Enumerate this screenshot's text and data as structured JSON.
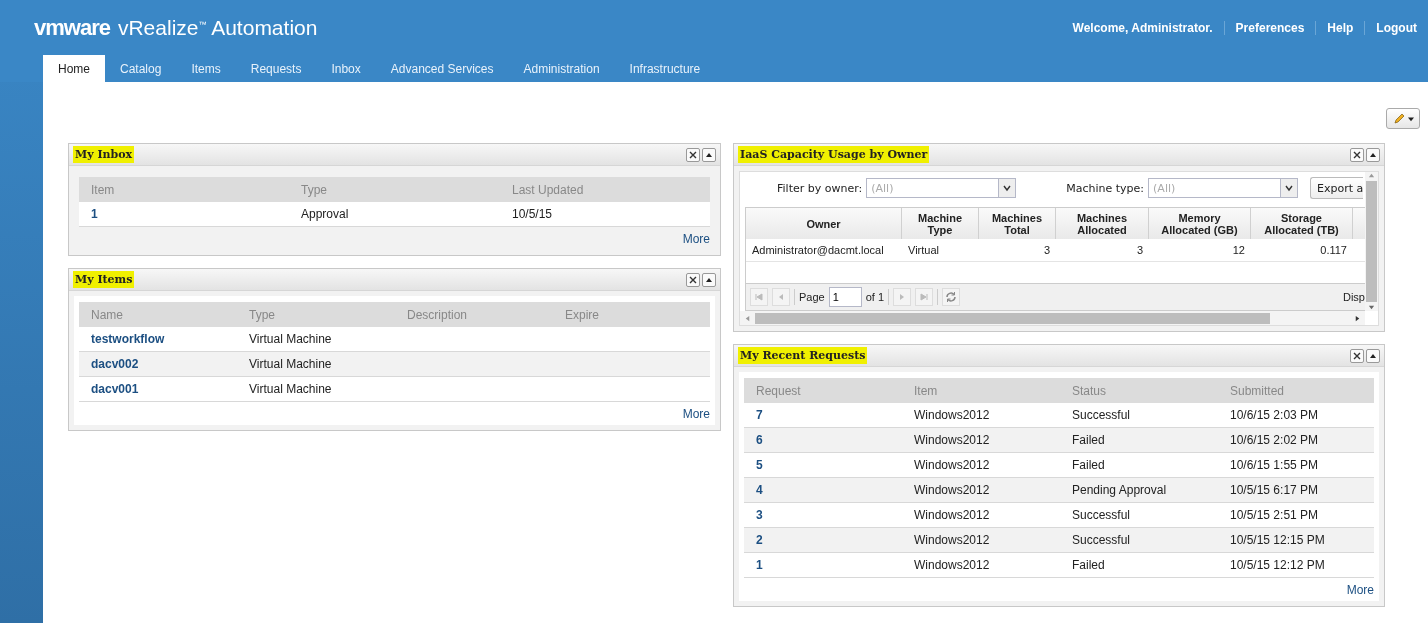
{
  "header": {
    "logo": "vmware",
    "product": "vRealize$^{™}$ Automation",
    "user_links": [
      "Welcome, Administrator.",
      "Preferences",
      "Help",
      "Logout"
    ]
  },
  "nav_tabs": [
    {
      "label": "Home",
      "selected": true
    },
    {
      "label": "Catalog",
      "selected": false
    },
    {
      "label": "Items",
      "selected": false
    },
    {
      "label": "Requests",
      "selected": false
    },
    {
      "label": "Inbox",
      "selected": false
    },
    {
      "label": "Advanced Services",
      "selected": false
    },
    {
      "label": "Administration",
      "selected": false
    },
    {
      "label": "Infrastructure",
      "selected": false
    }
  ],
  "my_inbox": {
    "title": "My Inbox",
    "columns": [
      "Item",
      "Type",
      "Last Updated"
    ],
    "rows": [
      [
        "1",
        "Approval",
        "10/5/15"
      ]
    ],
    "more": "More"
  },
  "my_items": {
    "title": "My Items",
    "columns": [
      "Name",
      "Type",
      "Description",
      "Expire"
    ],
    "rows": [
      [
        "testworkflow",
        "Virtual Machine",
        "",
        ""
      ],
      [
        "dacv002",
        "Virtual Machine",
        "",
        ""
      ],
      [
        "dacv001",
        "Virtual Machine",
        "",
        ""
      ]
    ],
    "more": "More"
  },
  "capacity": {
    "title": "IaaS Capacity Usage by Owner",
    "filter_label": "Filter by owner:",
    "filter_value": "(All)",
    "type_label": "Machine type:",
    "type_value": "(All)",
    "export": "Export a",
    "columns": [
      "Owner",
      "Machine Type",
      "Machines Total",
      "Machines Allocated",
      "Memory Allocated (GB)",
      "Storage Allocated (TB)"
    ],
    "rows": [
      [
        "Administrator@dacmt.local",
        "Virtual",
        "3",
        "3",
        "12",
        "0.117"
      ]
    ],
    "pager": {
      "page_label": "Page",
      "page": "1",
      "of": "of 1",
      "display": "Disp"
    }
  },
  "recent_requests": {
    "title": "My Recent Requests",
    "columns": [
      "Request",
      "Item",
      "Status",
      "Submitted"
    ],
    "rows": [
      [
        "7",
        "Windows2012",
        "Successful",
        "10/6/15 2:03 PM"
      ],
      [
        "6",
        "Windows2012",
        "Failed",
        "10/6/15 2:02 PM"
      ],
      [
        "5",
        "Windows2012",
        "Failed",
        "10/6/15 1:55 PM"
      ],
      [
        "4",
        "Windows2012",
        "Pending Approval",
        "10/5/15 6:17 PM"
      ],
      [
        "3",
        "Windows2012",
        "Successful",
        "10/5/15 2:51 PM"
      ],
      [
        "2",
        "Windows2012",
        "Successful",
        "10/5/15 12:15 PM"
      ],
      [
        "1",
        "Windows2012",
        "Failed",
        "10/5/15 12:12 PM"
      ]
    ],
    "more": "More"
  }
}
